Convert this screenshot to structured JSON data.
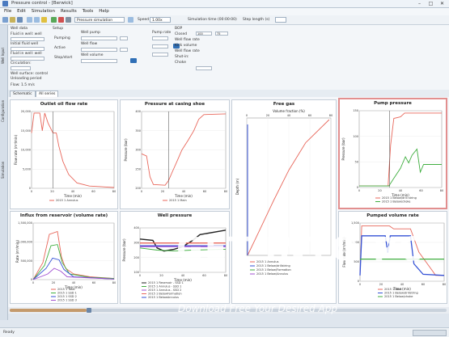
{
  "window": {
    "title": "Pressure control - [Berwick]",
    "min": "–",
    "max": "□",
    "close": "✕"
  },
  "menu": [
    "File",
    "Edit",
    "Simulation",
    "Results",
    "Tools",
    "Help"
  ],
  "toolbar": {
    "combo": "Pressure simulation",
    "speed_label": "Speed",
    "speed_value": "1.00x",
    "sim_time_label": "Simulation time (00:00:00)",
    "step_label": "Step length (s)"
  },
  "sidebar": [
    "Well Input",
    "Configuration",
    "Simulation"
  ],
  "panel": {
    "well_data": "Well data",
    "rows": [
      "Fluid in well: well",
      "Initial fluid well",
      "Fluid in well: well",
      "Circulation:",
      "Well surface: control",
      "Unloading period",
      "Flow: 1.5 m/s"
    ],
    "set_col": [
      "Setup",
      "Pumping",
      "Active",
      "Stop/start"
    ],
    "mid_col": [
      "Well pump",
      "Well flow",
      "Well volume"
    ],
    "bop": {
      "title": "BOP",
      "rows": [
        "Closed",
        "Well flow rate",
        "Kick volume",
        "Well flow rate",
        "Shut-in:",
        "Choke"
      ],
      "val1": "100",
      "val2": "75"
    },
    "pump_label": "Pump rate",
    "choke_label": "Choke"
  },
  "tabs": [
    "Schematic",
    "All series"
  ],
  "charts": [
    {
      "id": "outlet",
      "title": "Outlet oil flow rate",
      "xlabel": "Time (min)",
      "ylabel": "Flow rate (m³/min)",
      "yticks": [
        "20,000",
        "15,000",
        "10,000",
        "5,000",
        "0"
      ],
      "xticks": [
        "0",
        "20",
        "40",
        "60",
        "80"
      ],
      "legend": [
        "2015 1 Annulus"
      ]
    },
    {
      "id": "casing",
      "title": "Pressure at casing shoe",
      "xlabel": "Time (min)",
      "ylabel": "Pressure (bar)",
      "yticks": [
        "400",
        "350",
        "300",
        "250",
        "200"
      ],
      "xticks": [
        "0",
        "20",
        "40",
        "60",
        "80"
      ],
      "legend": [
        "2015 1 Main"
      ]
    },
    {
      "id": "freegas",
      "title": "Free gas",
      "xlabel": "Volume fraction (%)",
      "ylabel": "Depth (m)",
      "xticks": [
        "0",
        "20",
        "40",
        "60",
        "80"
      ],
      "legend": [
        "2015 1 Annulus",
        "2015 1 Below/drillstring",
        "2015 1 Below/Formation",
        "2015 1 Below/Annulus"
      ]
    },
    {
      "id": "pump",
      "title": "Pump pressure",
      "xlabel": "Time (min)",
      "ylabel": "Pressure (bar)",
      "yticks": [
        "150",
        "100",
        "50",
        "0"
      ],
      "xticks": [
        "0",
        "20",
        "40",
        "60",
        "80"
      ],
      "legend": [
        "2015 1 Below/drill string",
        "2015 1 Below/choke"
      ]
    },
    {
      "id": "influx",
      "title": "Influx from reservoir (volume rate)",
      "xlabel": "Time (min)",
      "ylabel": "Rate (m³/min)",
      "yticks": [
        "1,500,000",
        "1,000,000",
        "500,000",
        "0"
      ],
      "xticks": [
        "0",
        "20",
        "40",
        "60",
        "80"
      ],
      "legend": [
        "2015 1 Total",
        "2015 1 SSD 1",
        "2015 1 SSD 2",
        "2015 1 SSD 3"
      ]
    },
    {
      "id": "wellp",
      "title": "Well pressure",
      "xlabel": "Time (min)",
      "ylabel": "Pressure (bar)",
      "yticks": [
        "400",
        "300",
        "200",
        "100"
      ],
      "xticks": [
        "0",
        "20",
        "40",
        "60",
        "80"
      ],
      "legend": [
        "2015 1 Reservoir - SSD 1",
        "2015 1 Annulus - SSD 1",
        "2015 1 Annulus - SSD 2",
        "2015 1 BelowFormation",
        "2015 1 BelowAnnulus"
      ]
    },
    {
      "id": "pumped",
      "title": "Pumped volume rate",
      "xlabel": "Time (min)",
      "ylabel": "Flow rate (m³/min)",
      "yticks": [
        "1,500",
        "1,000",
        "500",
        "0"
      ],
      "xticks": [
        "0",
        "20",
        "40",
        "60",
        "80"
      ],
      "legend": [
        "2015 1 Total",
        "2015 1 Below/drillstring",
        "2015 1 Below/choke"
      ]
    }
  ],
  "watermark": {
    "main": "GET INTO PC",
    "sub": "Download Free Your Desired App"
  },
  "status": {
    "text": "Ready"
  },
  "colors": {
    "red": "#e8675b",
    "green": "#3fae3f",
    "blue": "#3452d6",
    "purple": "#a04fd0",
    "black": "#222222"
  }
}
